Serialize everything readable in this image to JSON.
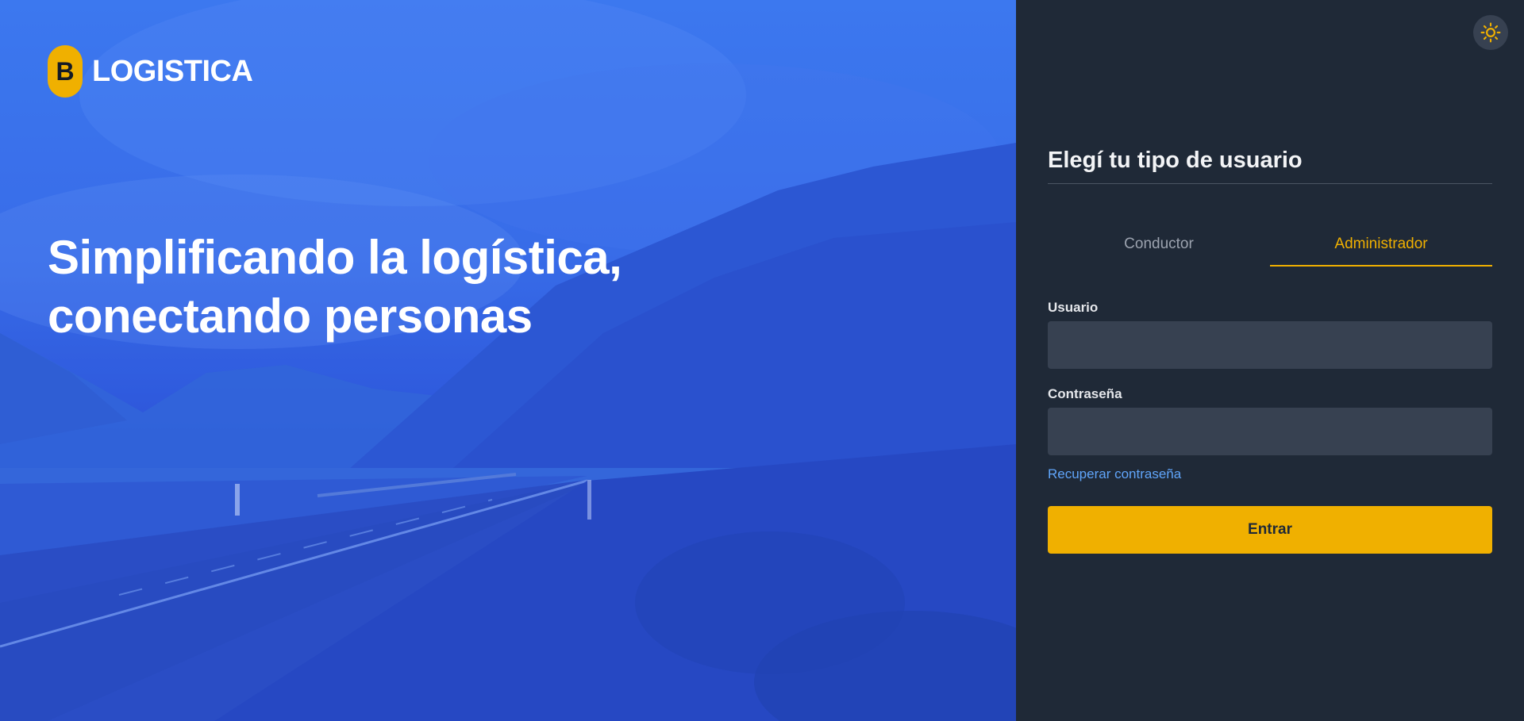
{
  "hero": {
    "brand_letter": "B",
    "brand_name": "LOGISTICA",
    "headline_line1": "Simplificando la logística,",
    "headline_line2": "conectando personas"
  },
  "panel": {
    "theme_icon": "sun-icon",
    "title": "Elegí tu tipo de usuario",
    "tabs": [
      {
        "label": "Conductor",
        "active": false
      },
      {
        "label": "Administrador",
        "active": true
      }
    ],
    "username_label": "Usuario",
    "username_value": "",
    "password_label": "Contraseña",
    "password_value": "",
    "recover_label": "Recuperar contraseña",
    "submit_label": "Entrar"
  },
  "colors": {
    "accent": "#f0b000",
    "panel_bg": "#1f2937",
    "input_bg": "#374151",
    "link": "#60a5fa",
    "hero_blue": "#3a6fe8"
  }
}
